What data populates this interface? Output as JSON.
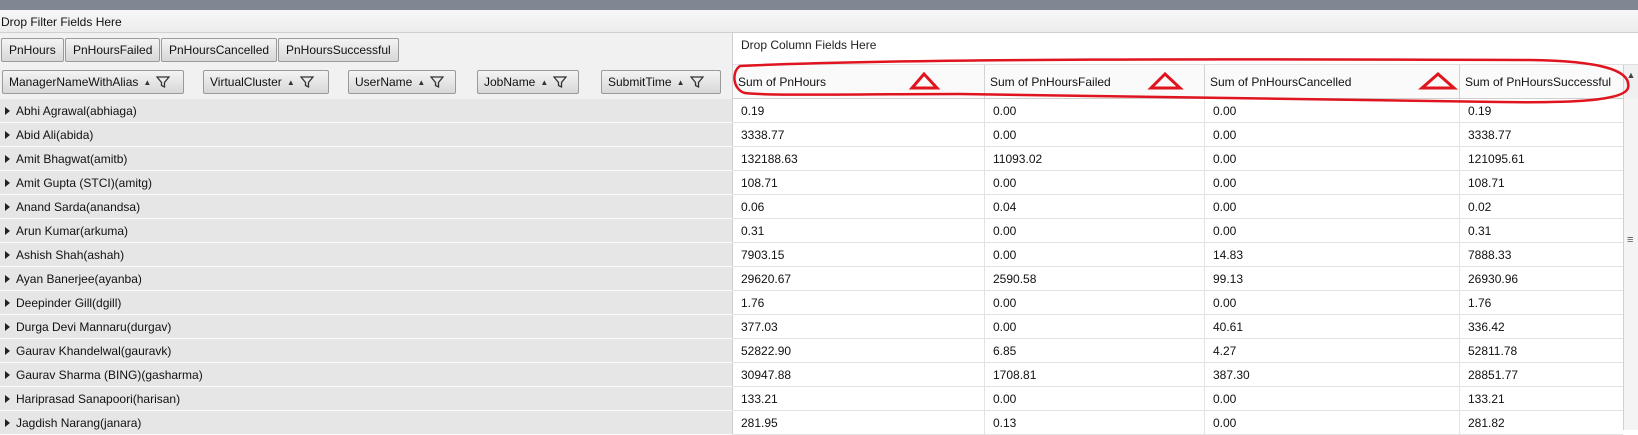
{
  "filter_zone": {
    "label": "Drop Filter Fields Here"
  },
  "data_fields": [
    "PnHours",
    "PnHoursFailed",
    "PnHoursCancelled",
    "PnHoursSuccessful"
  ],
  "column_zone": {
    "label": "Drop Column Fields Here"
  },
  "row_fields": [
    "ManagerNameWithAlias",
    "VirtualCluster",
    "UserName",
    "JobName",
    "SubmitTime"
  ],
  "columns": [
    "Sum of PnHours",
    "Sum of PnHoursFailed",
    "Sum of PnHoursCancelled",
    "Sum of PnHoursSuccessful"
  ],
  "rows": [
    {
      "label": "Abhi Agrawal(abhiaga)",
      "values": [
        "0.19",
        "0.00",
        "0.00",
        "0.19"
      ]
    },
    {
      "label": "Abid Ali(abida)",
      "values": [
        "3338.77",
        "0.00",
        "0.00",
        "3338.77"
      ]
    },
    {
      "label": "Amit Bhagwat(amitb)",
      "values": [
        "132188.63",
        "11093.02",
        "0.00",
        "121095.61"
      ]
    },
    {
      "label": "Amit Gupta (STCI)(amitg)",
      "values": [
        "108.71",
        "0.00",
        "0.00",
        "108.71"
      ]
    },
    {
      "label": "Anand Sarda(anandsa)",
      "values": [
        "0.06",
        "0.04",
        "0.00",
        "0.02"
      ]
    },
    {
      "label": "Arun Kumar(arkuma)",
      "values": [
        "0.31",
        "0.00",
        "0.00",
        "0.31"
      ]
    },
    {
      "label": "Ashish Shah(ashah)",
      "values": [
        "7903.15",
        "0.00",
        "14.83",
        "7888.33"
      ]
    },
    {
      "label": "Ayan Banerjee(ayanba)",
      "values": [
        "29620.67",
        "2590.58",
        "99.13",
        "26930.96"
      ]
    },
    {
      "label": "Deepinder Gill(dgill)",
      "values": [
        "1.76",
        "0.00",
        "0.00",
        "1.76"
      ]
    },
    {
      "label": "Durga Devi Mannaru(durgav)",
      "values": [
        "377.03",
        "0.00",
        "40.61",
        "336.42"
      ]
    },
    {
      "label": "Gaurav Khandelwal(gauravk)",
      "values": [
        "52822.90",
        "6.85",
        "4.27",
        "52811.78"
      ]
    },
    {
      "label": "Gaurav Sharma (BING)(gasharma)",
      "values": [
        "30947.88",
        "1708.81",
        "387.30",
        "28851.77"
      ]
    },
    {
      "label": "Hariprasad Sanapoori(harisan)",
      "values": [
        "133.21",
        "0.00",
        "0.00",
        "133.21"
      ]
    },
    {
      "label": "Jagdish Narang(janara)",
      "values": [
        "281.95",
        "0.13",
        "0.00",
        "281.82"
      ]
    }
  ],
  "colors": {
    "annotation": "#e0141e",
    "topbar": "#7f8792"
  }
}
